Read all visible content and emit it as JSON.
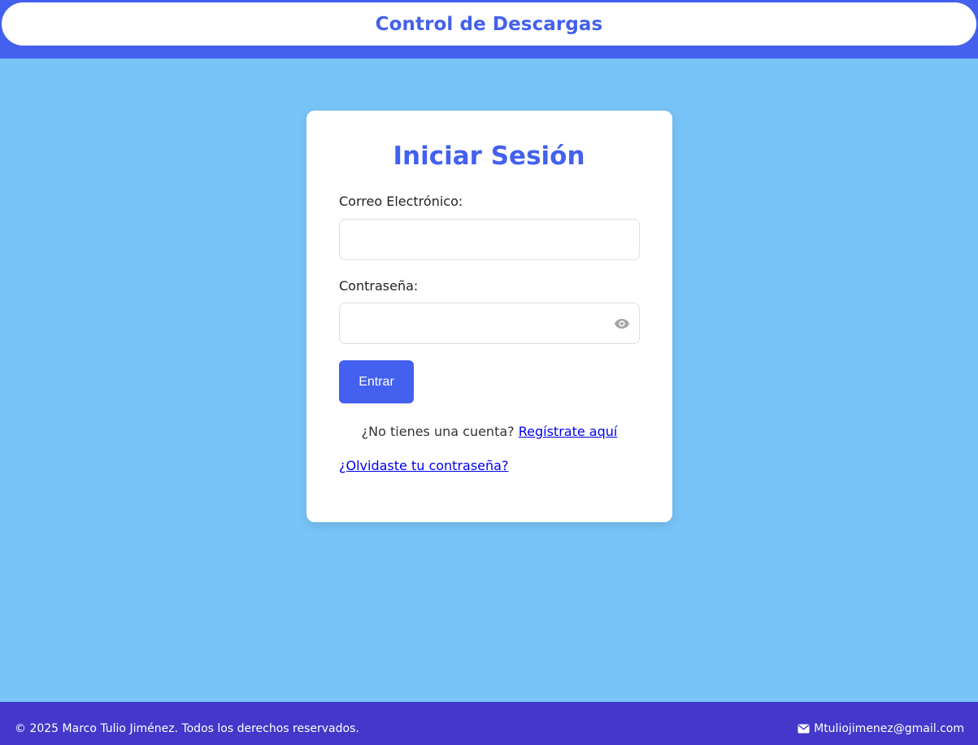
{
  "header": {
    "title": "Control de Descargas"
  },
  "login": {
    "title": "Iniciar Sesión",
    "email_label": "Correo Electrónico:",
    "email_value": "",
    "password_label": "Contraseña:",
    "password_value": "",
    "password_toggle_icon": "eye-icon",
    "submit_label": "Entrar",
    "register_prompt": "¿No tienes una cuenta?",
    "register_link": "Regístrate aquí",
    "forgot_link": "¿Olvidaste tu contraseña?"
  },
  "footer": {
    "copyright": "© 2025 Marco Tulio Jiménez. Todos los derechos reservados.",
    "email_icon": "envelope-icon",
    "email": "Mtuliojimenez@gmail.com"
  },
  "colors": {
    "primary": "#4361ee",
    "background": "#78c3f7",
    "footer": "#4338ca",
    "link": "#0000ee"
  }
}
